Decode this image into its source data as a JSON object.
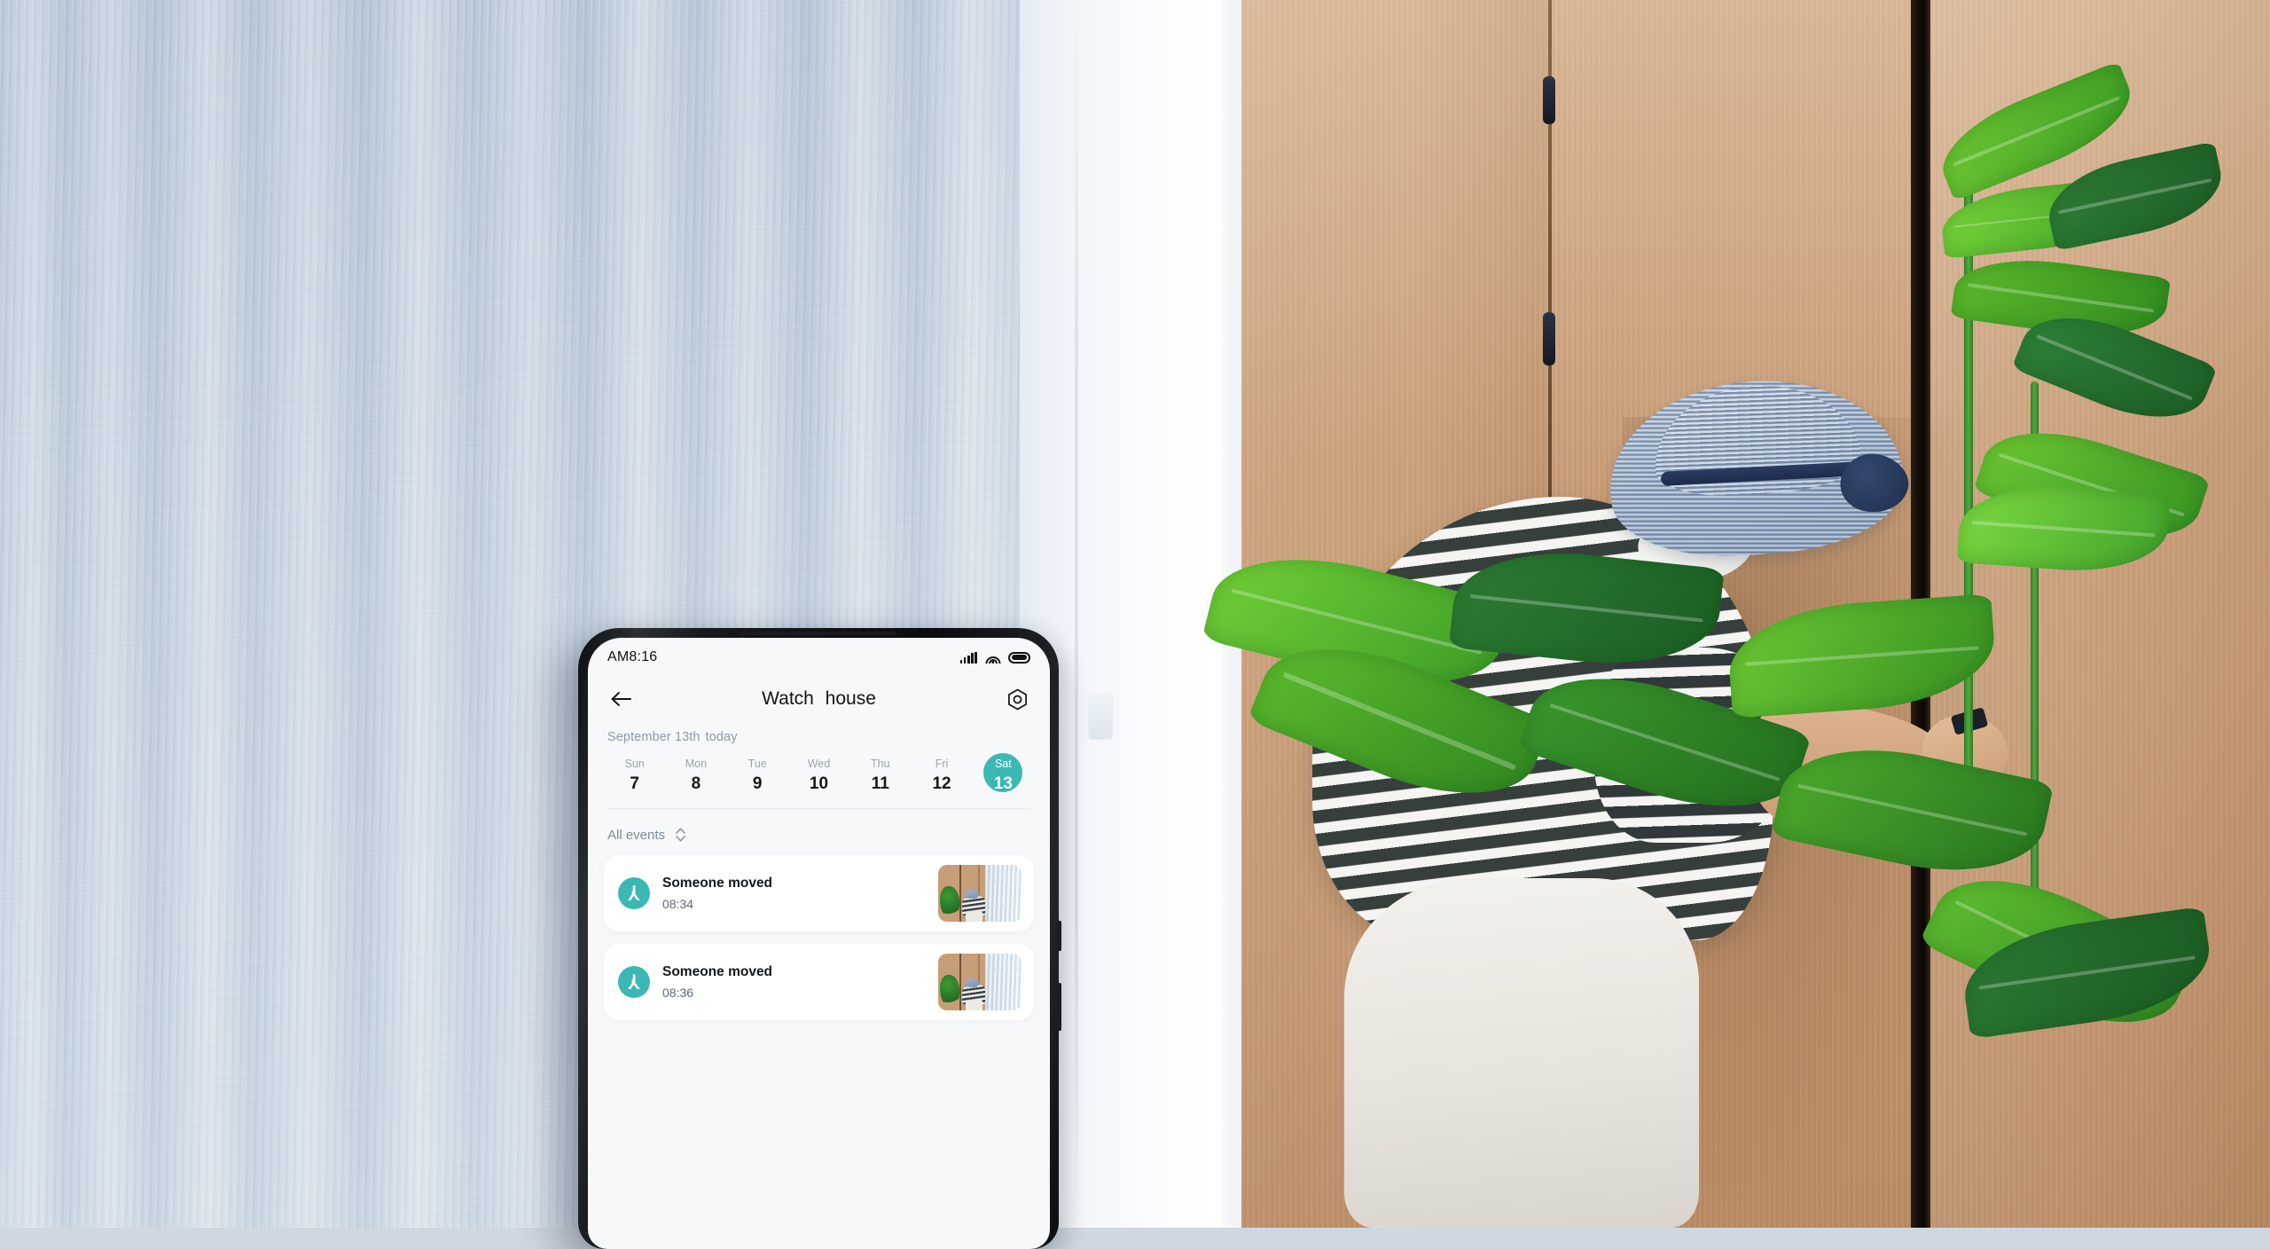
{
  "theme": {
    "accent_teal": "#3bb8b4",
    "screen_bg": "#f7f8f9",
    "card_bg": "#ffffff"
  },
  "status_bar": {
    "time": "AM8:16",
    "icons": [
      "signal-icon",
      "wifi-icon",
      "battery-icon"
    ]
  },
  "app_bar": {
    "back_icon": "back-arrow-icon",
    "title": "Watch  house",
    "settings_icon": "settings-hex-icon"
  },
  "date_section": {
    "header_date": "September 13th",
    "header_today": "today",
    "days": [
      {
        "name": "Sun",
        "num": "7",
        "selected": false
      },
      {
        "name": "Mon",
        "num": "8",
        "selected": false
      },
      {
        "name": "Tue",
        "num": "9",
        "selected": false
      },
      {
        "name": "Wed",
        "num": "10",
        "selected": false
      },
      {
        "name": "Thu",
        "num": "11",
        "selected": false
      },
      {
        "name": "Fri",
        "num": "12",
        "selected": false
      },
      {
        "name": "Sat",
        "num": "13",
        "selected": true
      }
    ]
  },
  "filter": {
    "label": "All events",
    "icon": "updown-chevron-icon"
  },
  "events": [
    {
      "icon": "motion-walk-icon",
      "title": "Someone moved",
      "time": "08:34",
      "thumb": "door-camera-snapshot"
    },
    {
      "icon": "motion-walk-icon",
      "title": "Someone moved",
      "time": "08:36",
      "thumb": "door-camera-snapshot"
    }
  ],
  "background_scene": {
    "description": "Room with sheer light-blue curtain on the left, tan wooden wardrobe doors on the right, a person in a striped shirt and blue sun hat opening a door, and green monstera plants at the far right."
  }
}
